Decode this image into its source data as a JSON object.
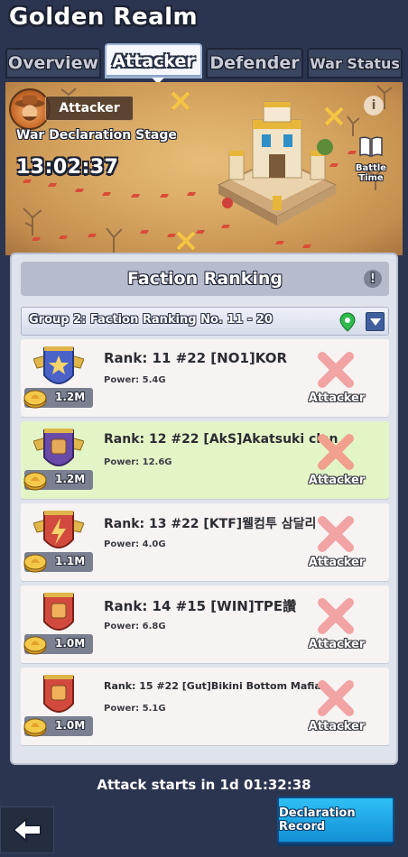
{
  "header": {
    "title": "Golden Realm"
  },
  "tabs": [
    {
      "label": "Overview"
    },
    {
      "label": "Attacker"
    },
    {
      "label": "Defender"
    },
    {
      "label": "War Status"
    }
  ],
  "map": {
    "role_label": "Attacker",
    "stage": "War Declaration Stage",
    "timer": "13:02:37",
    "battle_time_label": "Battle Time",
    "info_glyph": "i"
  },
  "panel": {
    "title": "Faction Ranking",
    "help_glyph": "!",
    "group_label": "Group 2: Faction Ranking No. 11 - 20"
  },
  "factions": [
    {
      "rank": "Rank: 11 #22 [NO1]KOR",
      "power": "Power: 5.4G",
      "members_power": "1.2M",
      "status": "Attacker",
      "emblem": "blue-wings-star",
      "highlighted": false
    },
    {
      "rank": "Rank: 12 #22 [AkS]Akatsuki clan",
      "power": "Power: 12.6G",
      "members_power": "1.2M",
      "status": "Attacker",
      "emblem": "purple-wings-fist",
      "highlighted": true
    },
    {
      "rank": "Rank: 13 #22 [KTF]웰컴투 삼달리",
      "power": "Power: 4.0G",
      "members_power": "1.1M",
      "status": "Attacker",
      "emblem": "red-wings-bolt",
      "highlighted": false
    },
    {
      "rank": "Rank: 14 #15 [WIN]TPE讚",
      "power": "Power: 6.8G",
      "members_power": "1.0M",
      "status": "Attacker",
      "emblem": "red-fist",
      "highlighted": false
    },
    {
      "rank": "Rank: 15 #22 [Gut]Bikini Bottom Mafia",
      "power": "Power: 5.1G",
      "members_power": "1.0M",
      "status": "Attacker",
      "emblem": "red-fist",
      "highlighted": false
    }
  ],
  "footer": {
    "attack_starts": "Attack starts in 1d 01:32:38",
    "declaration_record": "Declaration Record"
  },
  "colors": {
    "background": "#2b3550",
    "highlight_row": "#e3f5c6",
    "declaration_button": "#1ea8e8",
    "attacker_cross": "#f2a3a3"
  }
}
